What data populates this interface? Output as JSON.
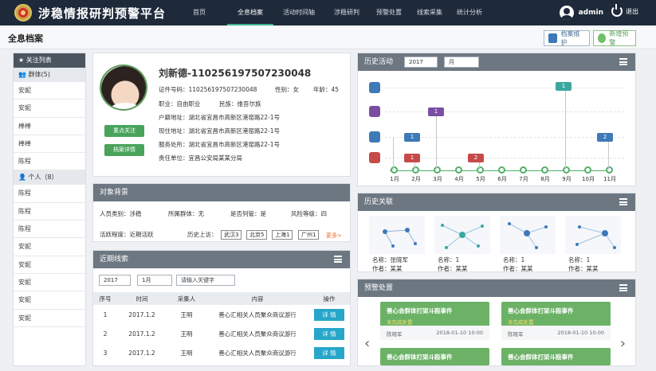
{
  "app": {
    "title": "涉稳情报研判预警平台"
  },
  "nav": [
    "首页",
    "全息档案",
    "活动时间轴",
    "涉稳研判",
    "预警处置",
    "线索采集",
    "统计分析"
  ],
  "user": {
    "name": "admin",
    "logout": "退出"
  },
  "page": {
    "title": "全息档案",
    "btn_archive": "档案维护",
    "btn_warning": "新增预警"
  },
  "follow": {
    "title": "关注列表",
    "group_title": "群体(5)",
    "groups": [
      "安妮",
      "安妮",
      "棒棒",
      "棒棒",
      "陈程"
    ],
    "person_title": "个人（8）",
    "persons": [
      "陈程",
      "陈程",
      "陈程",
      "安妮",
      "安妮",
      "安妮",
      "安妮",
      "安妮"
    ]
  },
  "profile": {
    "name": "刘新德-110256197507230048",
    "id_label": "证件号码：",
    "id": "110256197507230048",
    "gender": "性别：女",
    "age": "年龄：45",
    "job": "职业：自由职业",
    "nation": "民族：维吾尔族",
    "hukou": "户籍地址：湖北省宜昌市高新区港窑路22-1号",
    "address": "现住地址：湖北省宜昌市高新区港窑路22-1号",
    "work": "服务处所：湖北省宜昌市高新区港窑路22-1号",
    "unit": "责任单位：宜昌公安局某某分局",
    "btn_focus": "重点关注",
    "btn_detail": "档案详情"
  },
  "background": {
    "title": "对象背景",
    "type": "人员类别：涉稳",
    "group": "所属群体：无",
    "flag": "是否列管：是",
    "risk": "风险等级：四",
    "active": "活跃程度：近期活跃",
    "history": "历史上访：",
    "tags": [
      "武汉3",
      "北京5",
      "上海1",
      "广州1"
    ],
    "more": "更多>"
  },
  "leads": {
    "title": "近期线索",
    "year": "2017",
    "month": "1月",
    "placeholder": "请输入关键字",
    "headers": [
      "序号",
      "时间",
      "采集人",
      "内容",
      "操作"
    ],
    "rows": [
      [
        "1",
        "2017.1.2",
        "王明",
        "善心汇相关人员聚众商议游行",
        "详 情"
      ],
      [
        "2",
        "2017.1.2",
        "王明",
        "善心汇相关人员聚众商议游行",
        "详 情"
      ],
      [
        "3",
        "2017.1.2",
        "王明",
        "善心汇相关人员聚众商议游行",
        "详 情"
      ]
    ]
  },
  "history": {
    "title": "历史活动",
    "year": "2017",
    "month": "月",
    "months": [
      "1月",
      "2月",
      "3月",
      "4月",
      "5月",
      "6月",
      "7月",
      "8月",
      "9月",
      "10月",
      "11月"
    ],
    "events": [
      "1",
      "1",
      "1",
      "2",
      "1",
      "2"
    ]
  },
  "graph": {
    "title": "历史关联",
    "items": [
      {
        "name": "名称：张晓军",
        "author": "作者：某某"
      },
      {
        "name": "名称：1",
        "author": "作者：某某"
      },
      {
        "name": "名称：1",
        "author": "作者：某某"
      },
      {
        "name": "名称：1",
        "author": "作者：某某"
      }
    ]
  },
  "warning": {
    "title": "预警处置",
    "cards": [
      {
        "title": "善心会群体打架斗殴事件",
        "status": "未完成处置",
        "person": "陈晓军",
        "time": "2018-01-10 10:00"
      },
      {
        "title": "善心会群体打架斗殴事件",
        "status": "未完成处置",
        "person": "陈晓军",
        "time": "2018-01-10 10:00"
      },
      {
        "title": "善心会群体打架斗殴事件",
        "status": "",
        "person": "",
        "time": ""
      },
      {
        "title": "善心会群体打架斗殴事件",
        "status": "",
        "person": "",
        "time": ""
      }
    ]
  }
}
